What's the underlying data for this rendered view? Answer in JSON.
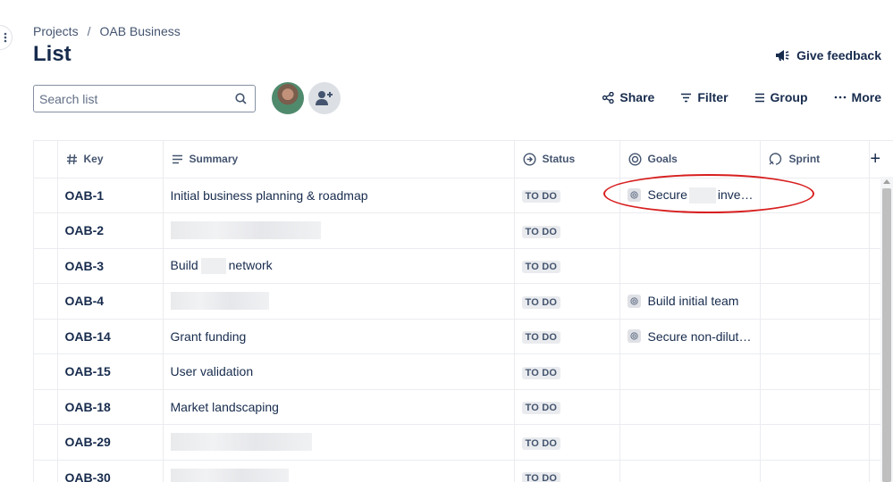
{
  "breadcrumb": {
    "root": "Projects",
    "separator": "/",
    "current": "OAB Business"
  },
  "page": {
    "title": "List"
  },
  "feedback": {
    "label": "Give feedback",
    "icon": "megaphone-icon"
  },
  "search": {
    "placeholder": "Search list",
    "value": "",
    "icon": "search-icon"
  },
  "people": {
    "avatar": "avatar",
    "add_icon": "add-person-icon"
  },
  "toolbar": {
    "share": "Share",
    "filter": "Filter",
    "group": "Group",
    "more": "More"
  },
  "columns": {
    "key": "Key",
    "summary": "Summary",
    "status": "Status",
    "goals": "Goals",
    "sprint": "Sprint",
    "add": "+"
  },
  "rows": [
    {
      "key": "OAB-1",
      "summary": "Initial business planning & roadmap",
      "status": "TO DO",
      "goal_pre": "Secure",
      "goal_post": "inve…"
    },
    {
      "key": "OAB-2",
      "summary": "",
      "status": "TO DO",
      "goal": ""
    },
    {
      "key": "OAB-3",
      "summary_pre": "Build",
      "summary_post": "network",
      "status": "TO DO",
      "goal": ""
    },
    {
      "key": "OAB-4",
      "summary": "",
      "status": "TO DO",
      "goal": "Build initial team"
    },
    {
      "key": "OAB-14",
      "summary": "Grant funding",
      "status": "TO DO",
      "goal": "Secure non-dilut…"
    },
    {
      "key": "OAB-15",
      "summary": "User validation",
      "status": "TO DO",
      "goal": ""
    },
    {
      "key": "OAB-18",
      "summary": "Market landscaping",
      "status": "TO DO",
      "goal": ""
    },
    {
      "key": "OAB-29",
      "summary": "",
      "status": "TO DO",
      "goal": ""
    },
    {
      "key": "OAB-30",
      "summary": "",
      "status": "TO DO",
      "goal": ""
    }
  ],
  "colors": {
    "text": "#172b4d",
    "subtle": "#44546f",
    "lozenge_bg": "#e9ebee",
    "highlight": "#d81f1f"
  }
}
